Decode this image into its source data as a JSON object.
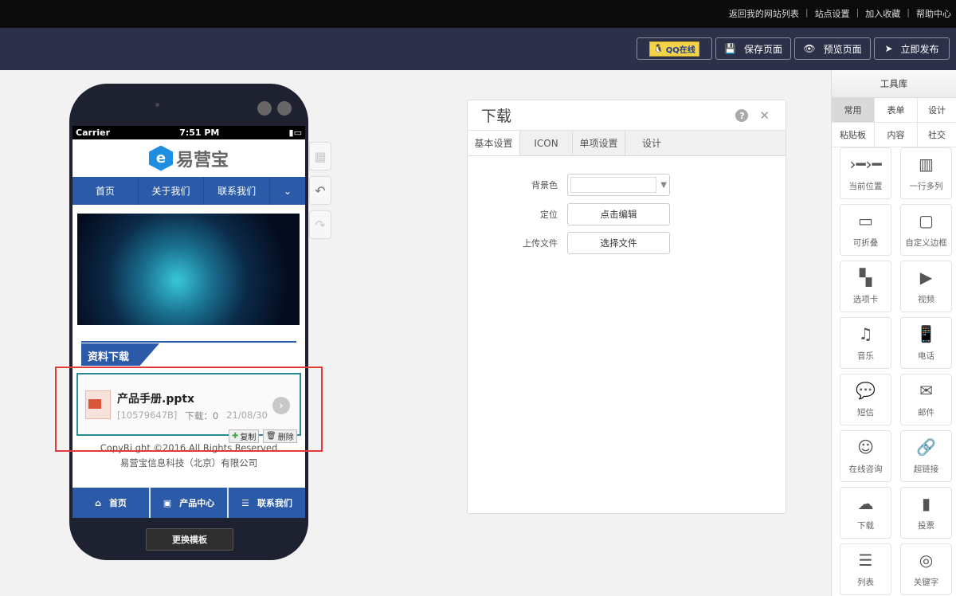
{
  "topbar": {
    "links": [
      "返回我的网站列表",
      "站点设置",
      "加入收藏",
      "帮助中心"
    ],
    "sep": "|"
  },
  "header": {
    "qq": "QQ在线",
    "save": "保存页面",
    "preview": "预览页面",
    "publish": "立即发布"
  },
  "phone": {
    "status": {
      "carrier": "Carrier",
      "time": "7:51 PM"
    },
    "logo": {
      "mark": "e",
      "text": "易营宝"
    },
    "nav": [
      "首页",
      "关于我们",
      "联系我们"
    ],
    "section_title": "资料下载",
    "file": {
      "name": "产品手册.pptx",
      "size": "[10579647B]",
      "downloads": "下载：0",
      "date": "21/08/30"
    },
    "actions": {
      "copy": "复制",
      "delete": "删除"
    },
    "copyright": "CopyRi ght ©2016 All Rights Reserved",
    "company": "易营宝信息科技（北京）有限公司",
    "bottom_nav": [
      "首页",
      "产品中心",
      "联系我们"
    ],
    "template_button": "更换模板"
  },
  "panel": {
    "title": "下载",
    "tabs": [
      "基本设置",
      "ICON",
      "单项设置",
      "设计"
    ],
    "fields": [
      {
        "label": "背景色",
        "value": ""
      },
      {
        "label": "定位",
        "button": "点击编辑"
      },
      {
        "label": "上传文件",
        "button": "选择文件"
      }
    ]
  },
  "sidebar": {
    "title": "工具库",
    "tabs": [
      "常用",
      "表单",
      "设计",
      "粘贴板",
      "内容",
      "社交"
    ],
    "tools": [
      "当前位置",
      "一行多列",
      "可折叠",
      "自定义边框",
      "选项卡",
      "视频",
      "音乐",
      "电话",
      "短信",
      "邮件",
      "在线咨询",
      "超链接",
      "下载",
      "投票",
      "列表",
      "关键字"
    ]
  }
}
